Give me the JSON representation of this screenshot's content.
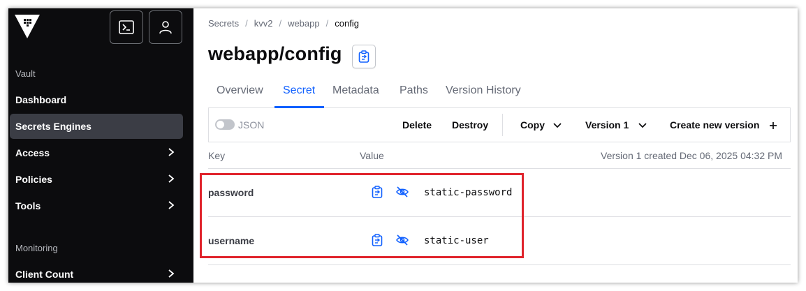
{
  "sidebar": {
    "sections": [
      {
        "label": "Vault",
        "items": [
          {
            "label": "Dashboard",
            "active": false,
            "has_chevron": false
          },
          {
            "label": "Secrets Engines",
            "active": true,
            "has_chevron": false
          },
          {
            "label": "Access",
            "active": false,
            "has_chevron": true
          },
          {
            "label": "Policies",
            "active": false,
            "has_chevron": true
          },
          {
            "label": "Tools",
            "active": false,
            "has_chevron": true
          }
        ]
      },
      {
        "label": "Monitoring",
        "items": [
          {
            "label": "Client Count",
            "active": false,
            "has_chevron": true
          }
        ]
      }
    ],
    "top_buttons": [
      "console-icon",
      "user-icon"
    ]
  },
  "breadcrumb": [
    "Secrets",
    "kvv2",
    "webapp",
    "config"
  ],
  "title": "webapp/config",
  "tabs": [
    {
      "label": "Overview",
      "active": false
    },
    {
      "label": "Secret",
      "active": true
    },
    {
      "label": "Metadata",
      "active": false
    },
    {
      "label": "Paths",
      "active": false
    },
    {
      "label": "Version History",
      "active": false
    }
  ],
  "toolbar": {
    "json_label": "JSON",
    "json_enabled": false,
    "delete": "Delete",
    "destroy": "Destroy",
    "copy": "Copy",
    "version": "Version 1",
    "create": "Create new version"
  },
  "table": {
    "headers": {
      "key": "Key",
      "value": "Value"
    },
    "version_note": "Version 1 created Dec 06, 2025 04:32 PM",
    "rows": [
      {
        "key": "password",
        "value": "static-password"
      },
      {
        "key": "username",
        "value": "static-user"
      }
    ]
  },
  "colors": {
    "accent": "#1060ff",
    "sidebar_bg": "#0c0c0e",
    "sidebar_active": "#3b3d45",
    "highlight": "#e0242c"
  }
}
